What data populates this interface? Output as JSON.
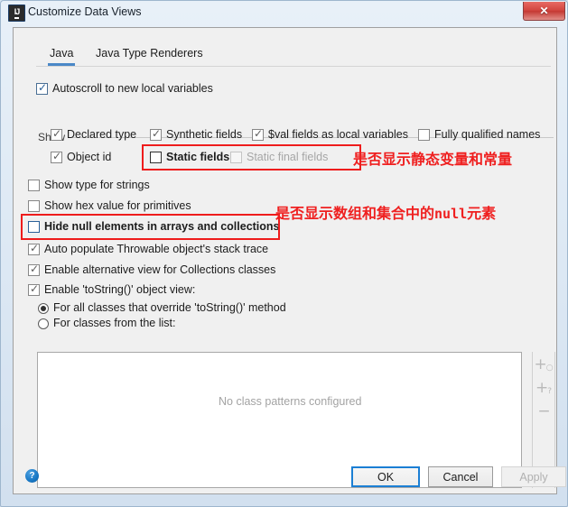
{
  "window": {
    "title": "Customize Data Views",
    "app_icon": "intellij-idea-icon",
    "close_label": "✕"
  },
  "tabs": [
    {
      "label": "Java",
      "active": true
    },
    {
      "label": "Java Type Renderers",
      "active": false
    }
  ],
  "autoscroll": {
    "label": "Autoscroll to new local variables",
    "checked": true
  },
  "show_group": {
    "label": "Show",
    "row1": [
      {
        "label": "Declared type",
        "checked": true
      },
      {
        "label": "Synthetic fields",
        "checked": true
      },
      {
        "label": "$val fields as local variables",
        "checked": true
      },
      {
        "label": "Fully qualified names",
        "checked": false
      }
    ],
    "row2": [
      {
        "label": "Object id",
        "checked": true
      },
      {
        "label": "Static fields",
        "checked": false
      },
      {
        "label": "Static final fields",
        "checked": false,
        "disabled": true
      }
    ]
  },
  "options": [
    {
      "label": "Show type for strings",
      "checked": false
    },
    {
      "label": "Show hex value for primitives",
      "checked": false
    },
    {
      "label": "Hide null elements in arrays and collections",
      "checked": false
    },
    {
      "label": "Auto populate Throwable object's stack trace",
      "checked": true
    },
    {
      "label": "Enable alternative view for Collections classes",
      "checked": true
    },
    {
      "label": "Enable 'toString()' object view:",
      "checked": true
    }
  ],
  "radios": [
    {
      "label": "For all classes that override 'toString()' method",
      "selected": true
    },
    {
      "label": "For classes from the list:",
      "selected": false
    }
  ],
  "list_panel": {
    "empty_text": "No class patterns configured",
    "toolbar": [
      {
        "name": "add",
        "glyph": "+",
        "sub": "○"
      },
      {
        "name": "add-pattern",
        "glyph": "+",
        "sub": "?"
      },
      {
        "name": "remove",
        "glyph": "−",
        "sub": ""
      }
    ]
  },
  "annotations": [
    {
      "text": "是否显示静态变量和常量"
    },
    {
      "text": "是否显示数组和集合中的",
      "mono": "null",
      "text2": "元素"
    }
  ],
  "footer": {
    "help_label": "?",
    "ok_label": "OK",
    "cancel_label": "Cancel",
    "apply_label": "Apply"
  },
  "colors": {
    "accent": "#1b7fd4",
    "annotation_red": "#ef2020",
    "tab_underline": "#4a88c7"
  }
}
